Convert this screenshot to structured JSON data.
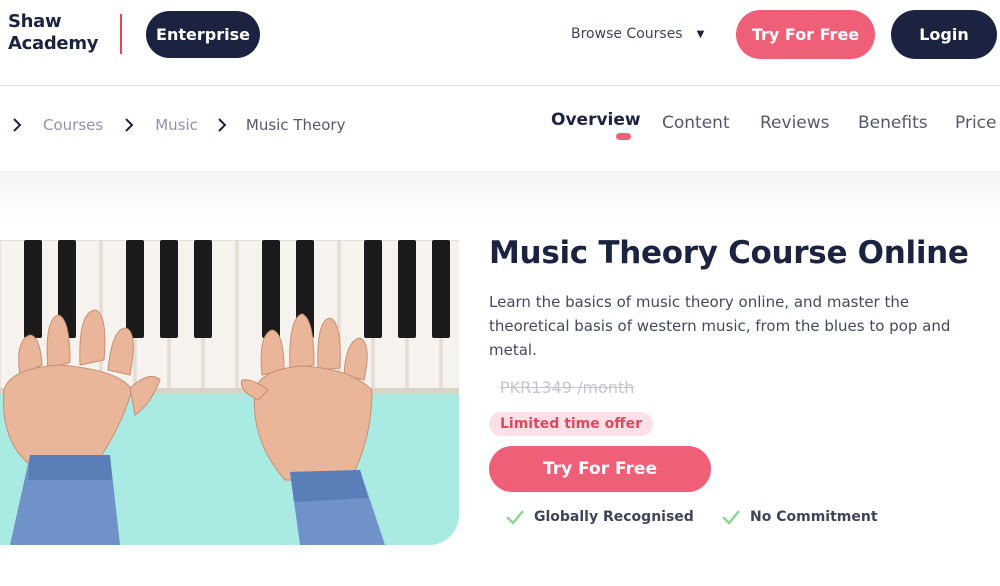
{
  "header": {
    "logo_line1": "Shaw",
    "logo_line2": "Academy",
    "enterprise_label": "Enterprise",
    "browse_label": "Browse Courses",
    "try_label": "Try For Free",
    "login_label": "Login"
  },
  "breadcrumb": [
    "Courses",
    "Music",
    "Music Theory"
  ],
  "tabs": {
    "overview": "Overview",
    "content": "Content",
    "reviews": "Reviews",
    "benefits": "Benefits",
    "price": "Price"
  },
  "course": {
    "title": "Music Theory Course Online",
    "description": "Learn the basics of music theory online, and master the theoretical basis of western music, from the blues to pop and metal.",
    "old_price": "PKR1349 /month",
    "offer_badge": "Limited time offer",
    "cta_label": "Try For Free",
    "features": [
      "Globally Recognised",
      "No Commitment"
    ]
  },
  "colors": {
    "navy": "#1c2340",
    "pink": "#ef5f78",
    "mint": "#a9ebe2",
    "check_green": "#8fd694"
  },
  "icons": [
    "chevron-right-icon",
    "caret-down-icon",
    "check-icon"
  ]
}
